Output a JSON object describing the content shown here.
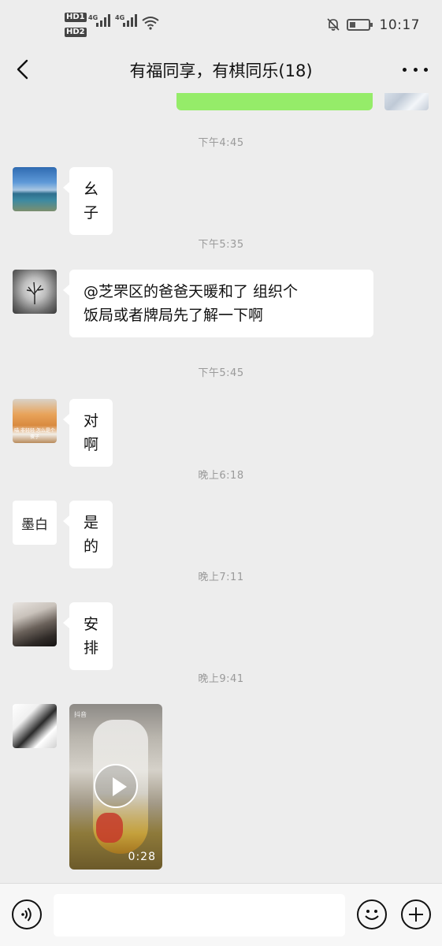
{
  "status_bar": {
    "hd1": "HD1",
    "hd2": "HD2",
    "net1": "4G",
    "net2": "4G",
    "time": "10:17"
  },
  "header": {
    "title": "有福同享，有棋同乐(18)",
    "back_icon": "chevron-left-icon",
    "more_icon": "more-dots-icon"
  },
  "messages": [
    {
      "timestamp": "下午4:45",
      "text": "幺子",
      "avatar_text": ""
    },
    {
      "timestamp": "下午5:35",
      "text_line1": "@芝罘区的爸爸天暖和了  组织个",
      "text_line2": "饭局或者牌局先了解一下啊"
    },
    {
      "timestamp": "下午5:45",
      "text": "对啊",
      "avatar_caption": "喵 非轻轻 怎么是个傻子"
    },
    {
      "timestamp": "晚上6:18",
      "text": "是的",
      "avatar_text": "墨白"
    },
    {
      "timestamp": "晚上7:11",
      "text": "安排"
    },
    {
      "timestamp": "晚上9:41",
      "video_duration": "0:28",
      "video_watermark": "抖音"
    }
  ],
  "input_bar": {
    "placeholder": "",
    "voice_icon": "voice-icon",
    "emoji_icon": "emoji-icon",
    "plus_icon": "plus-icon"
  },
  "colors": {
    "background": "#ededed",
    "bubble_self": "#95ec69",
    "bubble_other": "#ffffff",
    "timestamp": "#9a9a9a"
  }
}
